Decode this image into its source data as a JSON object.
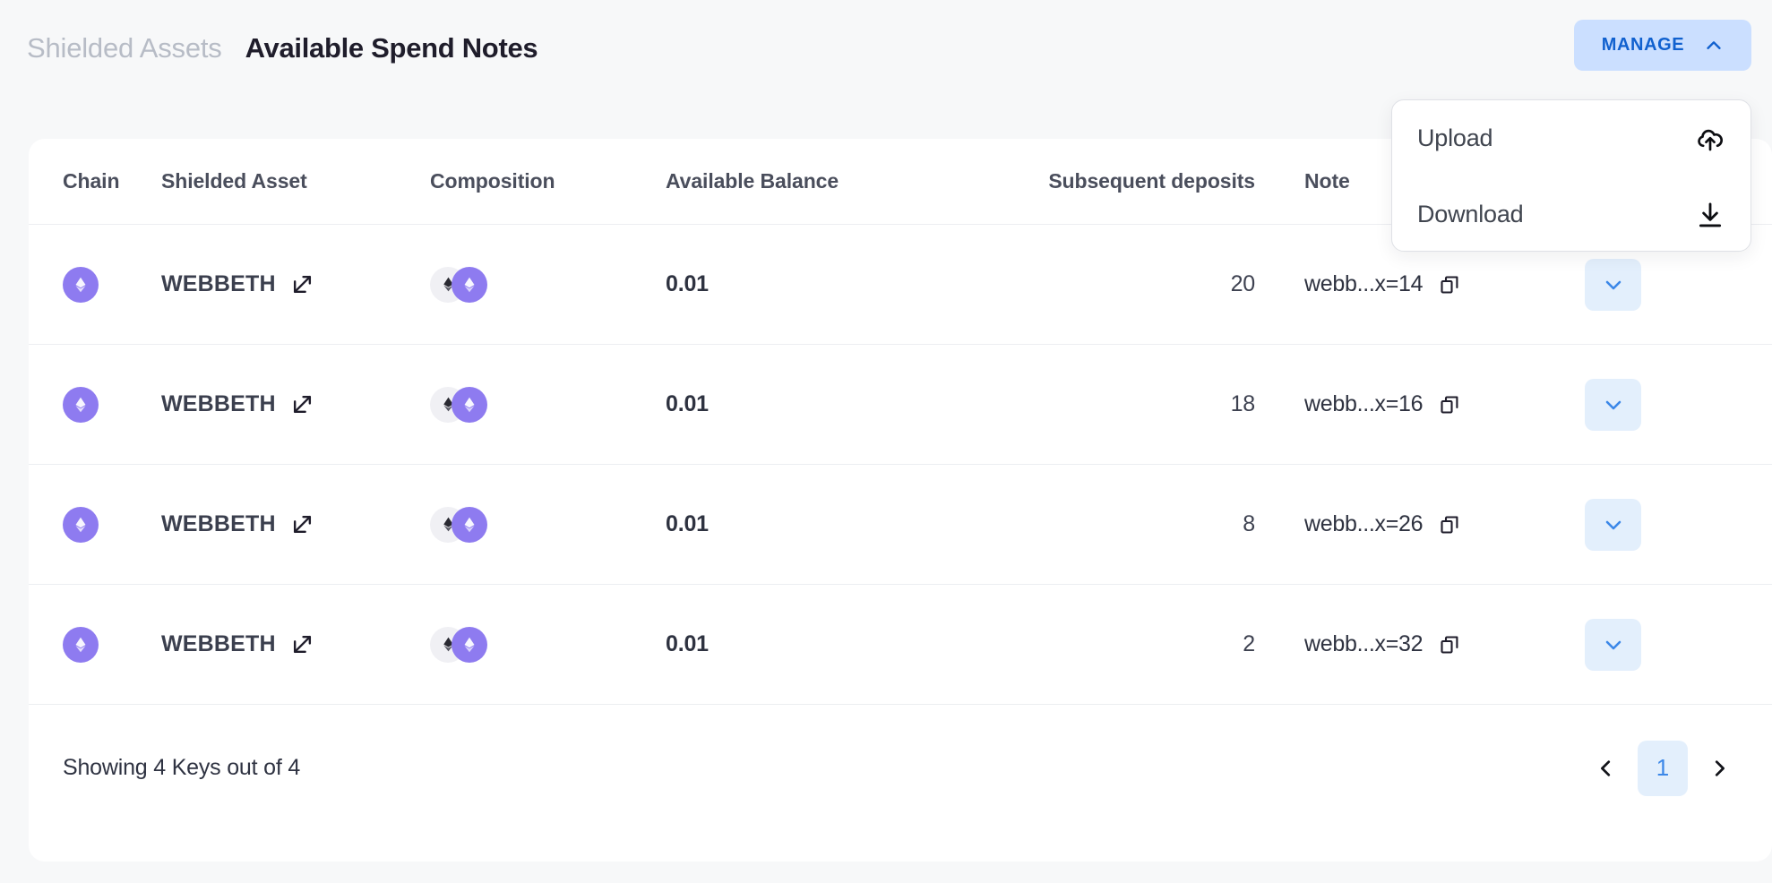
{
  "header": {
    "breadcrumb_parent": "Shielded Assets",
    "breadcrumb_current": "Available Spend Notes",
    "manage_label": "MANAGE",
    "manage_chevron_icon": "chevron-up-icon",
    "accent_blue": "#1161cf",
    "manage_bg": "#cbdfff"
  },
  "dropdown": {
    "open": true,
    "items": [
      {
        "label": "Upload",
        "icon": "cloud-upload-icon"
      },
      {
        "label": "Download",
        "icon": "download-icon"
      }
    ]
  },
  "table": {
    "columns": [
      "Chain",
      "Shielded Asset",
      "Composition",
      "Available Balance",
      "Subsequent deposits",
      "Note"
    ],
    "rows": [
      {
        "chain_icon": "ethereum-token-icon",
        "asset": "WEBBETH",
        "asset_link_icon": "external-link-icon",
        "composition": [
          "ethereum-token-icon",
          "webb-ethereum-token-icon"
        ],
        "balance": "0.01",
        "deposits": "20",
        "note": "webb...x=14",
        "copy_icon": "copy-icon",
        "expand_icon": "chevron-down-icon"
      },
      {
        "chain_icon": "ethereum-token-icon",
        "asset": "WEBBETH",
        "asset_link_icon": "external-link-icon",
        "composition": [
          "ethereum-token-icon",
          "webb-ethereum-token-icon"
        ],
        "balance": "0.01",
        "deposits": "18",
        "note": "webb...x=16",
        "copy_icon": "copy-icon",
        "expand_icon": "chevron-down-icon"
      },
      {
        "chain_icon": "ethereum-token-icon",
        "asset": "WEBBETH",
        "asset_link_icon": "external-link-icon",
        "composition": [
          "ethereum-token-icon",
          "webb-ethereum-token-icon"
        ],
        "balance": "0.01",
        "deposits": "8",
        "note": "webb...x=26",
        "copy_icon": "copy-icon",
        "expand_icon": "chevron-down-icon"
      },
      {
        "chain_icon": "ethereum-token-icon",
        "asset": "WEBBETH",
        "asset_link_icon": "external-link-icon",
        "composition": [
          "ethereum-token-icon",
          "webb-ethereum-token-icon"
        ],
        "balance": "0.01",
        "deposits": "2",
        "note": "webb...x=32",
        "copy_icon": "copy-icon",
        "expand_icon": "chevron-down-icon"
      }
    ]
  },
  "footer": {
    "showing_text": "Showing 4 Keys out of 4",
    "prev_icon": "chevron-left-icon",
    "next_icon": "chevron-right-icon",
    "current_page": "1"
  },
  "colors": {
    "page_bg": "#f7f8f9",
    "card_bg": "#ffffff",
    "token_purple": "#8e7bf0",
    "token_grey": "#f0f0f4",
    "pager_active_text": "#3c88e8",
    "pager_active_bg": "#e3effc"
  }
}
